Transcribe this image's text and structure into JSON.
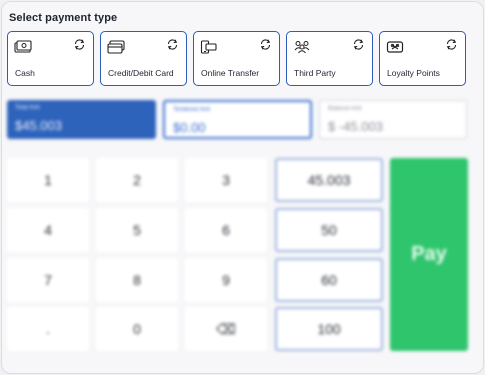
{
  "header": {
    "title": "Select payment type"
  },
  "payment_types": [
    {
      "label": "Cash",
      "icon": "cash-icon"
    },
    {
      "label": "Credit/Debit Card",
      "icon": "card-icon"
    },
    {
      "label": "Online Transfer",
      "icon": "online-transfer-icon"
    },
    {
      "label": "Third Party",
      "icon": "third-party-icon"
    },
    {
      "label": "Loyalty Points",
      "icon": "loyalty-icon"
    }
  ],
  "amounts": {
    "total": {
      "caption": "Total Amt",
      "value": "$45.003"
    },
    "tendered": {
      "caption": "Tendered Amt",
      "value": "$0.00"
    },
    "balance": {
      "caption": "Balance Amt",
      "value": "$ -45.003"
    }
  },
  "keypad": {
    "rows": [
      [
        "1",
        "2",
        "3"
      ],
      [
        "4",
        "5",
        "6"
      ],
      [
        "7",
        "8",
        "9"
      ],
      [
        ".",
        "0",
        "⌫"
      ]
    ],
    "quick_amounts": [
      "45.003",
      "50",
      "60",
      "100"
    ]
  },
  "pay_label": "Pay",
  "colors": {
    "accent": "#2f5cb8",
    "pay": "#2fc56d",
    "total_bg": "#2e63bc"
  }
}
